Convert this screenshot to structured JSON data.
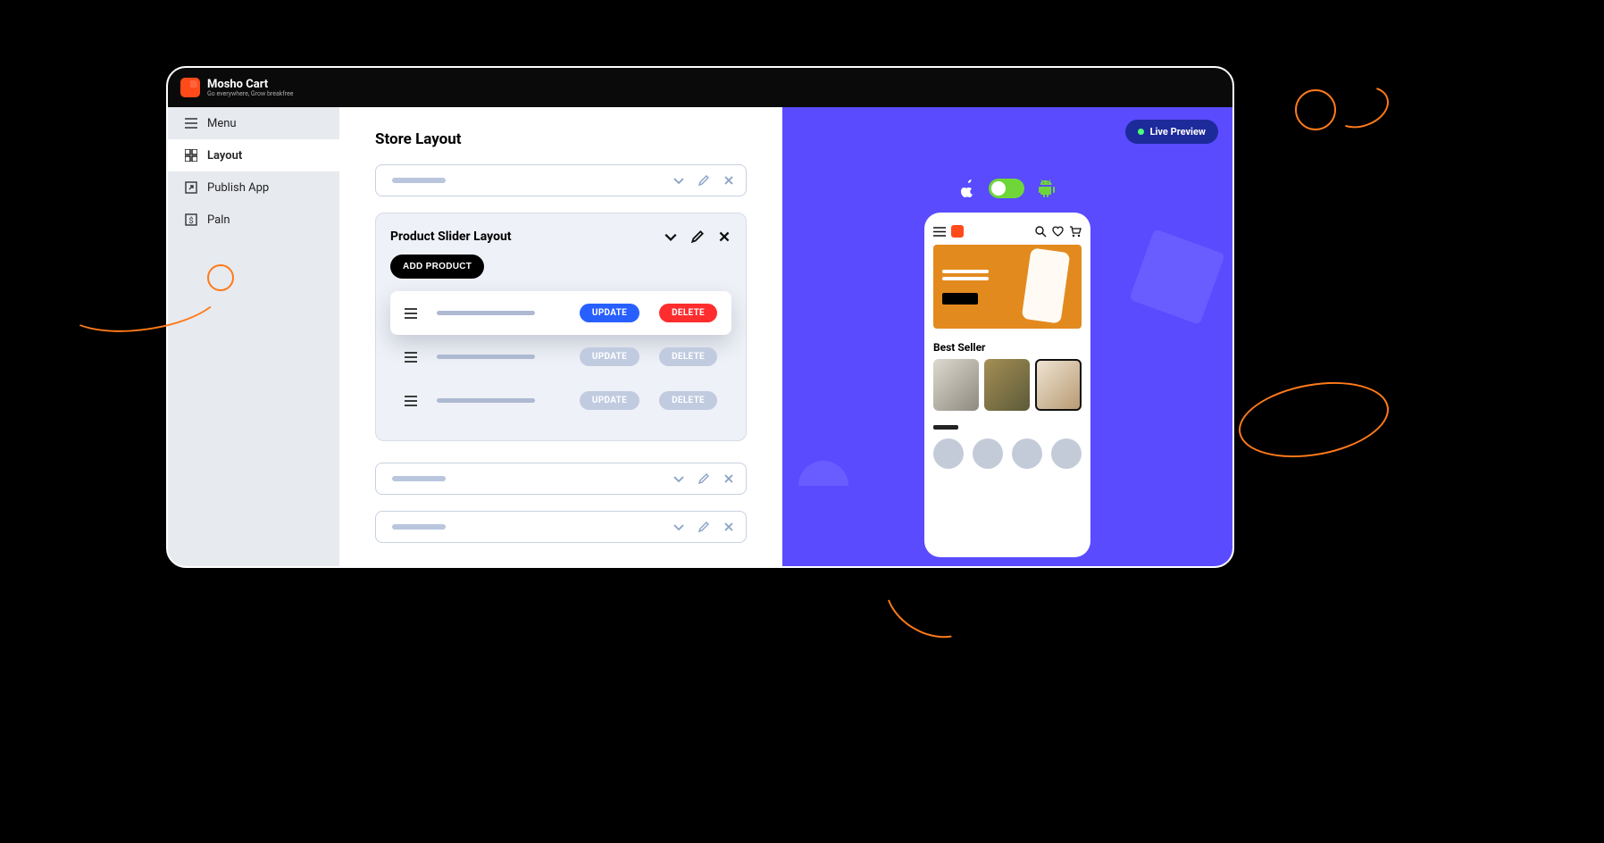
{
  "brand": {
    "name": "Mosho Cart",
    "tagline": "Go everywhere, Grow breakfree"
  },
  "sidebar": {
    "items": [
      {
        "label": "Menu"
      },
      {
        "label": "Layout"
      },
      {
        "label": "Publish App"
      },
      {
        "label": "Paln"
      }
    ]
  },
  "editor": {
    "title": "Store Layout",
    "slider_block": {
      "title": "Product Slider Layout",
      "add_label": "ADD PRODUCT",
      "update_label": "UPDATE",
      "delete_label": "DELETE"
    }
  },
  "preview": {
    "live_label": "Live Preview",
    "section_title": "Best Seller"
  }
}
